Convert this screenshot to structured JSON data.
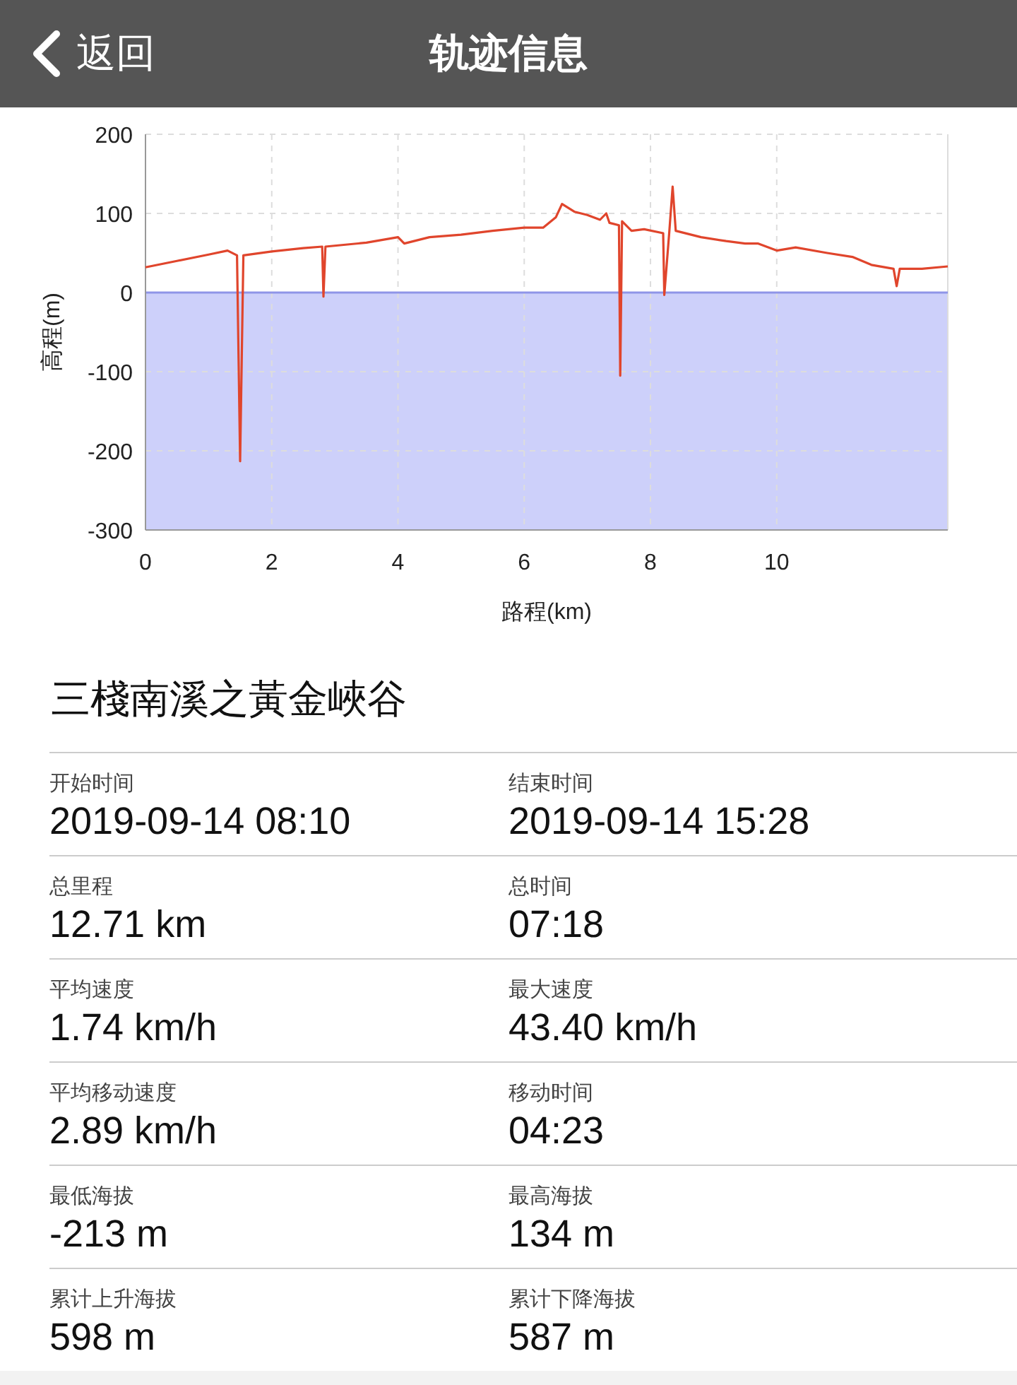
{
  "header": {
    "back_label": "返回",
    "title": "轨迹信息"
  },
  "chart": {
    "chart_data": {
      "type": "line",
      "xlabel": "路程(km)",
      "ylabel": "高程(m)",
      "xlim": [
        0,
        12.71
      ],
      "ylim": [
        -300,
        200
      ],
      "xticks": [
        0,
        2,
        4,
        6,
        8,
        10
      ],
      "yticks": [
        200,
        100,
        0,
        -100,
        -200,
        -300
      ],
      "grid": true,
      "bands": [
        {
          "axis": "y",
          "from": -300,
          "to": 0,
          "color": "#cdd0fa"
        }
      ],
      "ref_lines": [
        {
          "axis": "y",
          "value": 0,
          "color": "#8f95e8"
        }
      ],
      "x": [
        0,
        0.5,
        1.0,
        1.3,
        1.45,
        1.5,
        1.55,
        2.0,
        2.5,
        2.8,
        2.82,
        2.85,
        3.5,
        4.0,
        4.1,
        4.5,
        5.0,
        5.5,
        6.0,
        6.3,
        6.5,
        6.6,
        6.8,
        7.0,
        7.2,
        7.3,
        7.35,
        7.5,
        7.52,
        7.55,
        7.7,
        7.9,
        8.2,
        8.22,
        8.3,
        8.35,
        8.4,
        8.8,
        9.2,
        9.5,
        9.7,
        10.0,
        10.3,
        10.8,
        11.2,
        11.5,
        11.85,
        11.9,
        11.95,
        12.3,
        12.71
      ],
      "series": [
        {
          "color": "#e0452c",
          "values": [
            32,
            40,
            48,
            53,
            47,
            -213,
            47,
            52,
            56,
            58,
            -5,
            58,
            63,
            70,
            62,
            70,
            73,
            78,
            82,
            82,
            95,
            112,
            102,
            98,
            92,
            100,
            88,
            85,
            -105,
            90,
            78,
            80,
            75,
            -3,
            78,
            134,
            78,
            70,
            65,
            62,
            62,
            53,
            57,
            50,
            45,
            35,
            30,
            8,
            30,
            30,
            33
          ]
        }
      ]
    }
  },
  "track_name": "三棧南溪之黃金峽谷",
  "stats": [
    {
      "label": "开始时间",
      "value": "2019-09-14 08:10"
    },
    {
      "label": "结束时间",
      "value": "2019-09-14 15:28"
    },
    {
      "label": "总里程",
      "value": "12.71 km"
    },
    {
      "label": "总时间",
      "value": "07:18"
    },
    {
      "label": "平均速度",
      "value": "1.74 km/h"
    },
    {
      "label": "最大速度",
      "value": "43.40 km/h"
    },
    {
      "label": "平均移动速度",
      "value": "2.89 km/h"
    },
    {
      "label": "移动时间",
      "value": "04:23"
    },
    {
      "label": "最低海拔",
      "value": "-213 m"
    },
    {
      "label": "最高海拔",
      "value": "134 m"
    },
    {
      "label": "累计上升海拔",
      "value": "598 m"
    },
    {
      "label": "累计下降海拔",
      "value": "587 m"
    }
  ]
}
